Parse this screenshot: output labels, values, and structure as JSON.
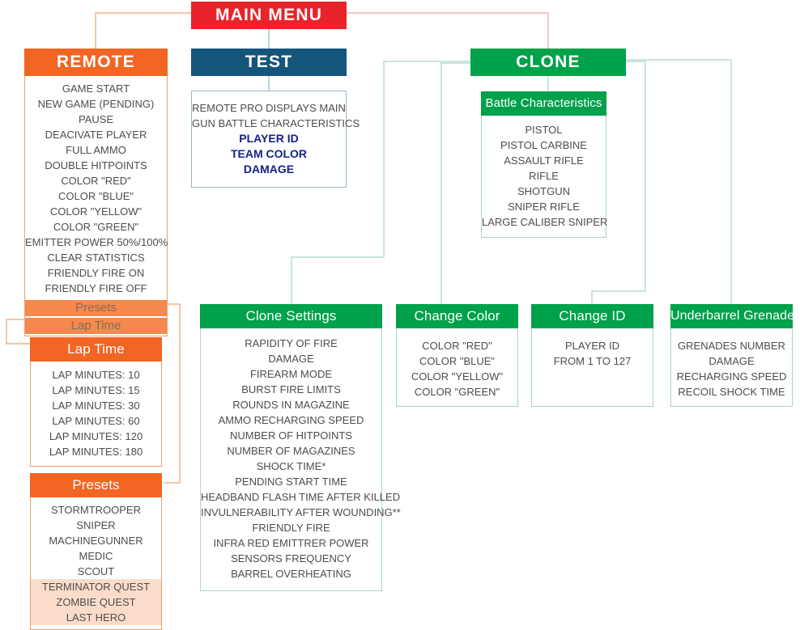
{
  "colors": {
    "main_menu": "#E8232A",
    "remote": "#F26522",
    "remote_strip": "#F5894E",
    "test": "#14557C",
    "clone": "#00A14B",
    "peach_highlight": "#FBDCCB",
    "navy_text": "#13218B",
    "item_text": "#4d4d4d"
  },
  "main_menu": {
    "title": "MAIN MENU"
  },
  "remote": {
    "title": "REMOTE",
    "items": [
      "GAME START",
      "NEW GAME (PENDING)",
      "PAUSE",
      "DEACIVATE PLAYER",
      "FULL AMMO",
      "DOUBLE HITPOINTS",
      "COLOR \"RED\"",
      "COLOR \"BLUE\"",
      "COLOR \"YELLOW\"",
      "COLOR \"GREEN\"",
      "EMITTER POWER 50%/100%",
      "CLEAR STATISTICS",
      "FRIENDLY FIRE ON",
      "FRIENDLY FIRE OFF"
    ],
    "strips": [
      "Presets",
      "Lap Time"
    ]
  },
  "lap_time": {
    "title": "Lap Time",
    "items": [
      "LAP MINUTES: 10",
      "LAP MINUTES: 15",
      "LAP MINUTES: 30",
      "LAP MINUTES: 60",
      "LAP MINUTES: 120",
      "LAP MINUTES: 180"
    ]
  },
  "presets": {
    "title": "Presets",
    "items": [
      {
        "label": "STORMTROOPER",
        "highlight": false
      },
      {
        "label": "SNIPER",
        "highlight": false
      },
      {
        "label": "MACHINEGUNNER",
        "highlight": false
      },
      {
        "label": "MEDIC",
        "highlight": false
      },
      {
        "label": "SCOUT",
        "highlight": false
      },
      {
        "label": "TERMINATOR QUEST",
        "highlight": true
      },
      {
        "label": "ZOMBIE QUEST",
        "highlight": true
      },
      {
        "label": "LAST HERO",
        "highlight": true
      }
    ]
  },
  "test": {
    "title": "TEST",
    "gray_lines": [
      "REMOTE PRO DISPLAYS MAIN",
      "GUN BATTLE CHARACTERISTICS"
    ],
    "navy_lines": [
      "PLAYER ID",
      "TEAM COLOR",
      "DAMAGE"
    ]
  },
  "clone": {
    "title": "CLONE"
  },
  "battle_characteristics": {
    "title": "Battle Characteristics",
    "items": [
      "PISTOL",
      "PISTOL CARBINE",
      "ASSAULT RIFLE",
      "RIFLE",
      "SHOTGUN",
      "SNIPER RIFLE",
      "LARGE CALIBER SNIPER"
    ]
  },
  "clone_settings": {
    "title": "Clone Settings",
    "items": [
      "RAPIDITY OF FIRE",
      "DAMAGE",
      "FIREARM MODE",
      "BURST FIRE LIMITS",
      "ROUNDS IN MAGAZINE",
      "AMMO RECHARGING SPEED",
      "NUMBER OF HITPOINTS",
      "NUMBER OF MAGAZINES",
      "SHOCK TIME*",
      "PENDING START TIME",
      "HEADBAND FLASH TIME AFTER KILLED",
      "INVULNERABILITY AFTER WOUNDING**",
      "FRIENDLY FIRE",
      "INFRA RED EMITTRER POWER",
      "SENSORS FREQUENCY",
      "BARREL OVERHEATING"
    ]
  },
  "change_color": {
    "title": "Change Color",
    "items": [
      "COLOR \"RED\"",
      "COLOR \"BLUE\"",
      "COLOR \"YELLOW\"",
      "COLOR \"GREEN\""
    ]
  },
  "change_id": {
    "title": "Change ID",
    "items": [
      "PLAYER ID",
      "FROM 1 TO 127"
    ]
  },
  "underbarrel_grenade": {
    "title": "Underbarrel Grenade",
    "items": [
      "GRENADES NUMBER",
      "DAMAGE",
      "RECHARGING SPEED",
      "RECOIL SHOCK TIME"
    ]
  }
}
